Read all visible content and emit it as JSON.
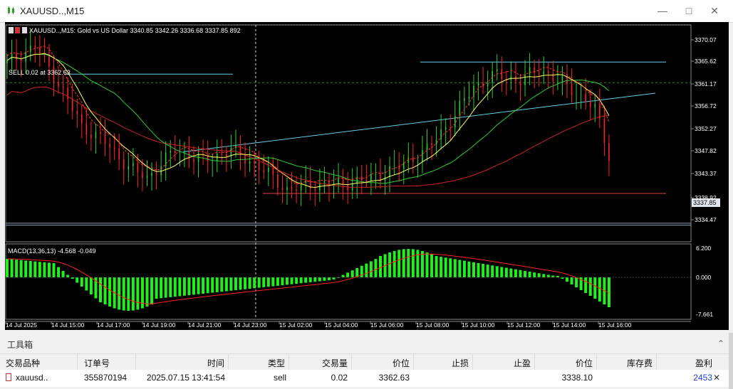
{
  "window": {
    "title": "XAUUSD..,M15",
    "minimize_icon": "minimize-icon",
    "restore_icon": "restore-icon",
    "close_icon": "close-icon"
  },
  "chart": {
    "header": "XAUUSD..,M15:  Gold vs US Dollar  3340.85 3342.26 3336.68 3337.85  892",
    "sell_label": "SELL 0.02 at 3362.63",
    "current_price": "3337.85",
    "price_ticks": [
      "3370.07",
      "3365.62",
      "3361.17",
      "3356.72",
      "3352.27",
      "3347.82",
      "3343.37",
      "3338.92",
      "3334.47"
    ],
    "macd_label": "MACD(13,36,13) -4.568 -0.049",
    "macd_ticks": [
      "6.200",
      "0.000",
      "-7.661"
    ],
    "time_ticks": [
      "14 Jul 2025",
      "14 Jul 15:00",
      "14 Jul 17:00",
      "14 Jul 19:00",
      "14 Jul 21:00",
      "14 Jul 23:00",
      "15 Jul 02:00",
      "15 Jul 04:00",
      "15 Jul 06:00",
      "15 Jul 08:00",
      "15 Jul 10:00",
      "15 Jul 12:00",
      "15 Jul 14:00",
      "15 Jul 16:00"
    ],
    "colors": {
      "bull": "#32cd32",
      "bear": "#ff2222",
      "ma_fast": "#ffff66",
      "ma_slow": "#33cc33",
      "ma_long": "#cc2222",
      "trend": "#66ccee",
      "macd_hist": "#22ee22",
      "macd_signal": "#ff2020",
      "sell_line": "#2e8b2e"
    }
  },
  "toolbox": {
    "label": "工具箱",
    "columns": [
      "交易品种",
      "订单号",
      "时间",
      "类型",
      "交易量",
      "价位",
      "止损",
      "止盈",
      "价位",
      "库存费",
      "盈利"
    ],
    "row": {
      "symbol": "xauusd..",
      "order": "355870194",
      "time": "2025.07.15 13:41:54",
      "type": "sell",
      "volume": "0.02",
      "open_price": "3362.63",
      "sl": "",
      "tp": "",
      "price": "3338.10",
      "swap": "",
      "profit": "2453"
    }
  }
}
